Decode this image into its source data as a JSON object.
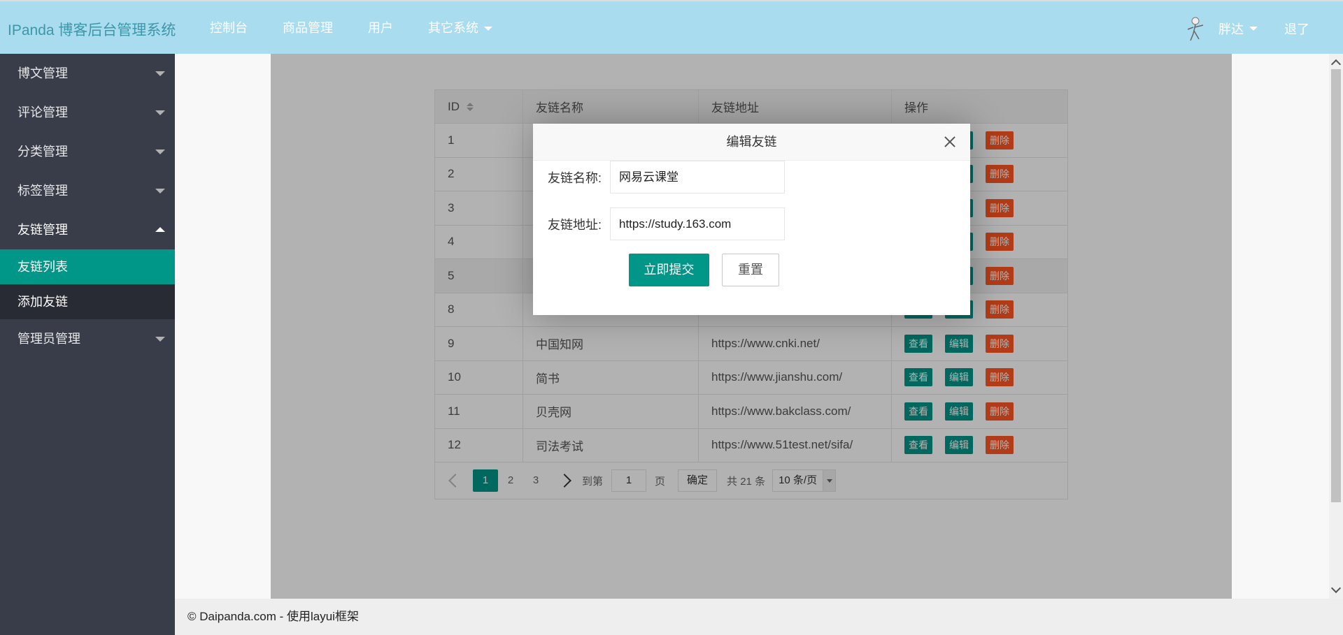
{
  "header": {
    "logo": "IPanda 博客后台管理系统",
    "nav": [
      "控制台",
      "商品管理",
      "用户",
      "其它系统"
    ],
    "user": "胖达",
    "logout": "退了"
  },
  "sidebar": {
    "items": [
      {
        "label": "博文管理"
      },
      {
        "label": "评论管理"
      },
      {
        "label": "分类管理"
      },
      {
        "label": "标签管理"
      },
      {
        "label": "友链管理",
        "children": [
          "友链列表",
          "添加友链"
        ]
      },
      {
        "label": "管理员管理"
      }
    ]
  },
  "table": {
    "headers": [
      "ID",
      "友链名称",
      "友链地址",
      "操作"
    ],
    "actions": {
      "view": "查看",
      "edit": "编辑",
      "delete": "删除"
    },
    "rows": [
      {
        "id": "1",
        "name": "",
        "url": ""
      },
      {
        "id": "2",
        "name": "",
        "url": ""
      },
      {
        "id": "3",
        "name": "",
        "url": ""
      },
      {
        "id": "4",
        "name": "",
        "url": ""
      },
      {
        "id": "5",
        "name": "",
        "url": ""
      },
      {
        "id": "8",
        "name": "",
        "url": ""
      },
      {
        "id": "9",
        "name": "中国知网",
        "url": "https://www.cnki.net/"
      },
      {
        "id": "10",
        "name": "简书",
        "url": "https://www.jianshu.com/"
      },
      {
        "id": "11",
        "name": "贝壳网",
        "url": "https://www.bakclass.com/"
      },
      {
        "id": "12",
        "name": "司法考试",
        "url": "https://www.51test.net/sifa/"
      }
    ]
  },
  "pager": {
    "pages": [
      "1",
      "2",
      "3"
    ],
    "goto": "到第",
    "goto_value": "1",
    "page_unit": "页",
    "confirm": "确定",
    "total": "共 21 条",
    "per_page": "10 条/页"
  },
  "dialog": {
    "title": "编辑友链",
    "name_label": "友链名称:",
    "name_value": "网易云课堂",
    "url_label": "友链地址:",
    "url_value": "https://study.163.com",
    "submit": "立即提交",
    "reset": "重置"
  },
  "footer": "© Daipanda.com - 使用layui框架",
  "colors": {
    "primary": "#009688",
    "danger": "#ff5722",
    "header": "#a9dcef",
    "sidebar": "#393d49"
  }
}
